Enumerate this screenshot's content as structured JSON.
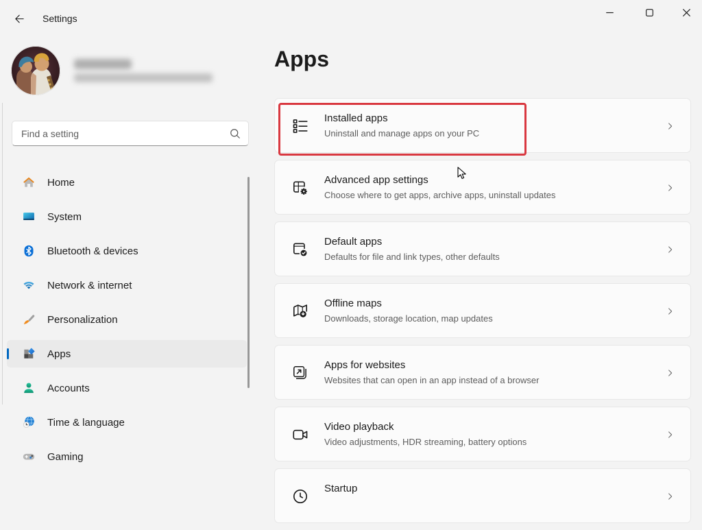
{
  "titlebar": {
    "title": "Settings",
    "back_icon": "back-arrow-icon",
    "controls": [
      "minimize-icon",
      "maximize-icon",
      "close-icon"
    ]
  },
  "profile": {
    "redacted": true
  },
  "search": {
    "placeholder": "Find a setting",
    "icon": "search-icon"
  },
  "sidebar": {
    "items": [
      {
        "label": "Home",
        "icon": "home",
        "selected": false
      },
      {
        "label": "System",
        "icon": "system",
        "selected": false
      },
      {
        "label": "Bluetooth & devices",
        "icon": "bluetooth",
        "selected": false
      },
      {
        "label": "Network & internet",
        "icon": "network",
        "selected": false
      },
      {
        "label": "Personalization",
        "icon": "personalization",
        "selected": false
      },
      {
        "label": "Apps",
        "icon": "apps",
        "selected": true
      },
      {
        "label": "Accounts",
        "icon": "accounts",
        "selected": false
      },
      {
        "label": "Time & language",
        "icon": "time-language",
        "selected": false
      },
      {
        "label": "Gaming",
        "icon": "gaming",
        "selected": false
      }
    ]
  },
  "main": {
    "title": "Apps",
    "cards": [
      {
        "title": "Installed apps",
        "subtitle": "Uninstall and manage apps on your PC",
        "icon": "installed-apps",
        "annotated": true
      },
      {
        "title": "Advanced app settings",
        "subtitle": "Choose where to get apps, archive apps, uninstall updates",
        "icon": "advanced-app-settings"
      },
      {
        "title": "Default apps",
        "subtitle": "Defaults for file and link types, other defaults",
        "icon": "default-apps"
      },
      {
        "title": "Offline maps",
        "subtitle": "Downloads, storage location, map updates",
        "icon": "offline-maps"
      },
      {
        "title": "Apps for websites",
        "subtitle": "Websites that can open in an app instead of a browser",
        "icon": "apps-for-websites"
      },
      {
        "title": "Video playback",
        "subtitle": "Video adjustments, HDR streaming, battery options",
        "icon": "video-playback"
      },
      {
        "title": "Startup",
        "subtitle": "",
        "icon": "startup"
      }
    ]
  },
  "annotation": {
    "shape": "rectangle",
    "color": "#d93840",
    "target": "Installed apps"
  },
  "colors": {
    "accent": "#0067c0",
    "background": "#f3f3f3",
    "card": "#fbfbfb",
    "selected_item": "#eaeaea"
  }
}
